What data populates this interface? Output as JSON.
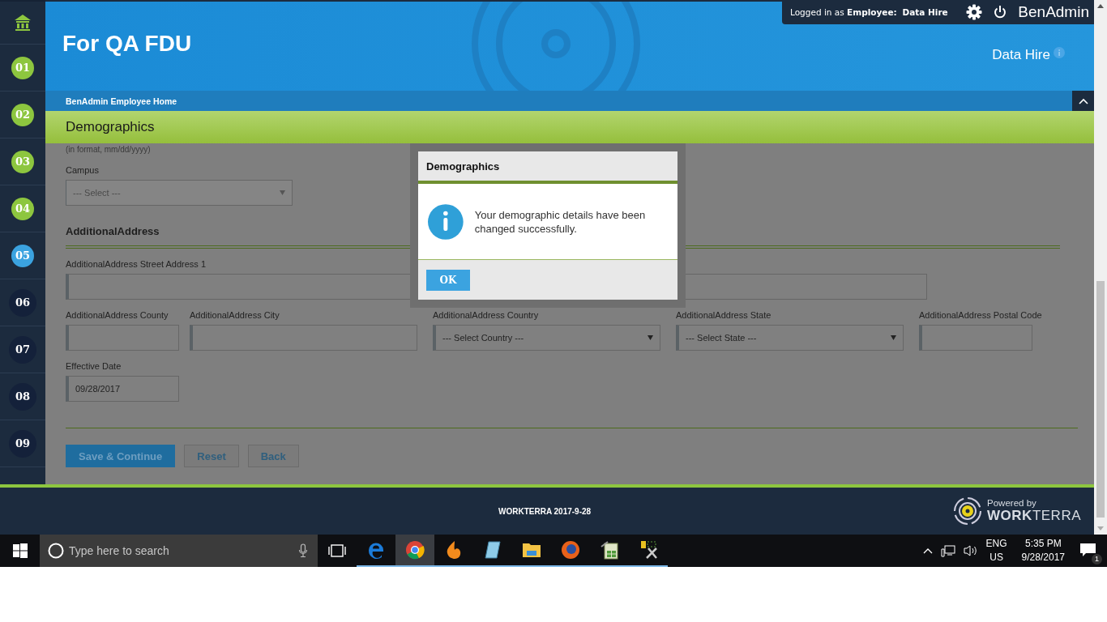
{
  "sidebar": {
    "steps": [
      {
        "label": "01",
        "done": true,
        "selected": false
      },
      {
        "label": "02",
        "done": true,
        "selected": false
      },
      {
        "label": "03",
        "done": true,
        "selected": false
      },
      {
        "label": "04",
        "done": true,
        "selected": false
      },
      {
        "label": "05",
        "done": false,
        "selected": true
      },
      {
        "label": "06",
        "done": false,
        "selected": false
      },
      {
        "label": "07",
        "done": false,
        "selected": false
      },
      {
        "label": "08",
        "done": false,
        "selected": false
      },
      {
        "label": "09",
        "done": false,
        "selected": false
      }
    ]
  },
  "header": {
    "title": "For QA FDU",
    "login_prefix": "Logged in as",
    "login_role": "Employee:",
    "login_name": "Data Hire",
    "app_name": "BenAdmin",
    "user_name": "Data Hire",
    "breadcrumb": "BenAdmin Employee Home"
  },
  "section_title": "Demographics",
  "form": {
    "date_hint": "(in format, mm/dd/yyyy)",
    "campus": {
      "label": "Campus",
      "placeholder": "--- Select ---",
      "disabled": true
    },
    "address_heading": "AdditionalAddress",
    "rows": [
      [
        {
          "label": "AdditionalAddress Street Address 1",
          "kind": "text"
        },
        {
          "kind": "text"
        }
      ],
      [
        {
          "label": "AdditionalAddress County",
          "kind": "text"
        },
        {
          "label": "AdditionalAddress City",
          "kind": "text"
        },
        {
          "label": "AdditionalAddress Country",
          "kind": "select",
          "placeholder": "--- Select Country ---"
        },
        {
          "label": "AdditionalAddress State",
          "kind": "select",
          "placeholder": "--- Select State ---"
        },
        {
          "label": "AdditionalAddress Postal Code",
          "kind": "text"
        }
      ],
      [
        {
          "label": "Effective Date",
          "kind": "text",
          "value": "09/28/2017"
        }
      ]
    ],
    "buttons": [
      {
        "label": "Save & Continue",
        "kind": "primary"
      },
      {
        "label": "Reset",
        "kind": "secondary"
      },
      {
        "label": "Back",
        "kind": "secondary"
      }
    ]
  },
  "dialog": {
    "title": "Demographics",
    "message": "Your demographic details have been changed successfully.",
    "button": "OK"
  },
  "footer": {
    "text": "WORKTERRA 2017-9-28",
    "powered_by": "Powered by",
    "brand": "**WORK**TERRA"
  },
  "taskbar": {
    "search_placeholder": "Type here to search",
    "apps": [
      {
        "kind": "edge",
        "running": true,
        "selected": false
      },
      {
        "kind": "chrome",
        "running": true,
        "selected": true
      },
      {
        "kind": "flame",
        "running": true,
        "selected": false
      },
      {
        "kind": "notepad",
        "running": true,
        "selected": false
      },
      {
        "kind": "folder",
        "running": true,
        "selected": false
      },
      {
        "kind": "firefox",
        "running": true,
        "selected": false
      },
      {
        "kind": "sheet",
        "running": true,
        "selected": false
      },
      {
        "kind": "tools",
        "running": true,
        "selected": false
      }
    ],
    "language": "ENG",
    "region": "US",
    "time": "5:35 PM",
    "date": "9/28/2017",
    "notifications": "1"
  }
}
